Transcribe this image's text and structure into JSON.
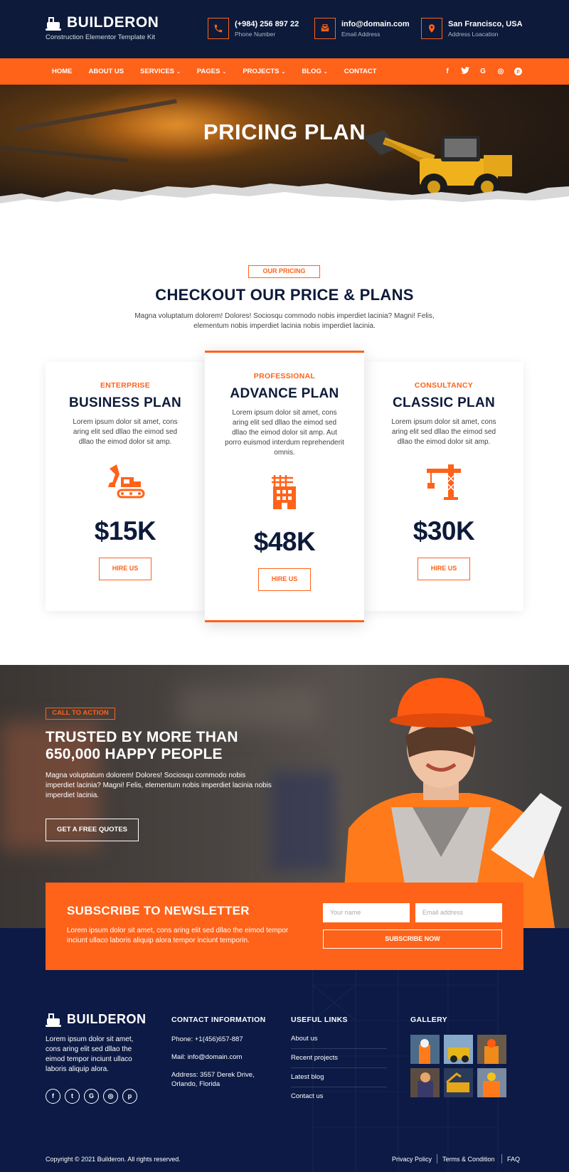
{
  "header": {
    "brand": "BUILDERON",
    "tagline": "Construction Elementor Template Kit",
    "phone": {
      "value": "(+984) 256 897 22",
      "label": "Phone Number",
      "icon": "phone-icon"
    },
    "email": {
      "value": "info@domain.com",
      "label": "Email Address",
      "icon": "mail-icon"
    },
    "location": {
      "value": "San Francisco, USA",
      "label": "Address Loacation",
      "icon": "location-pin-icon"
    }
  },
  "nav": {
    "items": [
      {
        "label": "HOME",
        "dropdown": false
      },
      {
        "label": "ABOUT US",
        "dropdown": false
      },
      {
        "label": "SERVICES",
        "dropdown": true
      },
      {
        "label": "PAGES",
        "dropdown": true
      },
      {
        "label": "PROJECTS",
        "dropdown": true
      },
      {
        "label": "BLOG",
        "dropdown": true
      },
      {
        "label": "CONTACT",
        "dropdown": false
      }
    ],
    "social": [
      "facebook-icon",
      "twitter-icon",
      "google-icon",
      "instagram-icon",
      "pinterest-icon"
    ],
    "glyphs": {
      "facebook": "f",
      "twitter": "t",
      "google": "G",
      "instagram": "◎",
      "pinterest": "p",
      "chevron": "⌄"
    }
  },
  "hero": {
    "title": "PRICING PLAN"
  },
  "pricing": {
    "tag": "OUR PRICING",
    "title": "CHECKOUT OUR PRICE & PLANS",
    "description": "Magna voluptatum dolorem! Dolores! Sociosqu commodo nobis imperdiet lacinia? Magni! Felis, elementum nobis imperdiet lacinia nobis imperdiet lacinia.",
    "plans": [
      {
        "category": "ENTERPRISE",
        "title": "BUSINESS PLAN",
        "description": "Lorem ipsum dolor sit amet, cons aring elit sed dllao the eimod sed dllao the eimod dolor sit amp.",
        "price": "$15K",
        "button": "HIRE US",
        "icon": "excavator-icon"
      },
      {
        "category": "PROFESSIONAL",
        "title": "ADVANCE PLAN",
        "description": "Lorem ipsum dolor sit amet, cons aring elit sed dllao the eimod sed dllao the eimod dolor sit amp. Aut porro euismod interdum reprehenderit omnis.",
        "price": "$48K",
        "button": "HIRE US",
        "icon": "building-construction-icon"
      },
      {
        "category": "CONSULTANCY",
        "title": "CLASSIC PLAN",
        "description": "Lorem ipsum dolor sit amet, cons aring elit sed dllao the eimod sed dllao the eimod dolor sit amp.",
        "price": "$30K",
        "button": "HIRE US",
        "icon": "tower-crane-icon"
      }
    ]
  },
  "cta": {
    "tag": "CALL TO ACTION",
    "title": "TRUSTED BY MORE THAN 650,000 HAPPY PEOPLE",
    "description": "Magna voluptatum dolorem! Dolores! Sociosqu commodo nobis imperdiet lacinia? Magni! Felis, elementum nobis imperdiet lacinia nobis imperdiet lacinia.",
    "button": "GET A FREE QUOTES"
  },
  "newsletter": {
    "title": "SUBSCRIBE TO NEWSLETTER",
    "description": "Lorem ipsum dolor sit amet, cons aring elit sed dllao the eimod tempor inciunt ullaco laboris aliquip alora tempor inciunt temporin.",
    "name_placeholder": "Your name",
    "email_placeholder": "Email address",
    "button": "SUBSCRIBE NOW"
  },
  "footer": {
    "brand": "BUILDERON",
    "about": "Lorem ipsum dolor sit amet, cons aring elit sed dllao the eimod tempor inciunt ullaco laboris aliquip alora.",
    "contact_heading": "CONTACT INFORMATION",
    "phone": "Phone: +1(456)657-887",
    "mail": "Mail: info@domain.com",
    "address": "Address: 3557 Derek Drive, Orlando, Florida",
    "links_heading": "USEFUL LINKS",
    "links": [
      "About us",
      "Recent projects",
      "Latest blog",
      "Contact us"
    ],
    "gallery_heading": "GALLERY",
    "copyright": "Copyright © 2021 Builderon. All rights reserved.",
    "legal": [
      "Privacy Policy",
      "Terms & Condition",
      "FAQ"
    ]
  },
  "colors": {
    "accent": "#ff6219",
    "navy": "#0d1a3a",
    "footer": "#0c1a45"
  }
}
